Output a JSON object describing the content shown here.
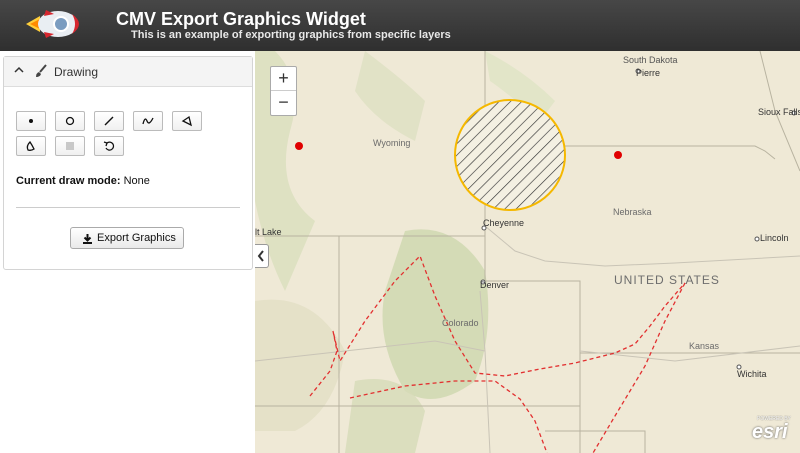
{
  "header": {
    "title": "CMV Export Graphics Widget",
    "subtitle": "This is an example of exporting graphics from specific layers",
    "logo_icon": "rocket-icon"
  },
  "panel": {
    "title": "Drawing",
    "collapse_icon": "chevron-up-icon",
    "title_icon": "paintbrush-icon",
    "tools": [
      "point-icon",
      "circle-icon",
      "line-icon",
      "freehand-line-icon",
      "polygon-icon",
      "freehand-polygon-icon",
      "stop-icon",
      "undo-icon"
    ],
    "mode_label": "Current draw mode:",
    "mode_value": "None",
    "export_label": "Export Graphics",
    "export_icon": "download-icon"
  },
  "map": {
    "zoom_in": "+",
    "zoom_out": "−",
    "toggle_icon": "chevron-left-icon",
    "labels": {
      "south_dakota": "South Dakota",
      "pierre": "Pierre",
      "sioux_falls": "Sioux Falls",
      "wyoming": "Wyoming",
      "nebraska": "Nebraska",
      "cheyenne": "Cheyenne",
      "lincoln": "Lincoln",
      "salt_lake": "lt Lake",
      "united_states": "UNITED STATES",
      "denver": "Denver",
      "colorado": "Colorado",
      "kansas": "Kansas",
      "wichita": "Wichita"
    },
    "esri_powered": "POWERED BY",
    "esri": "esri",
    "colors": {
      "circle_stroke": "#f5b800",
      "circle_hatch": "#333333",
      "point": "#e00000",
      "line": "#e83030"
    }
  }
}
